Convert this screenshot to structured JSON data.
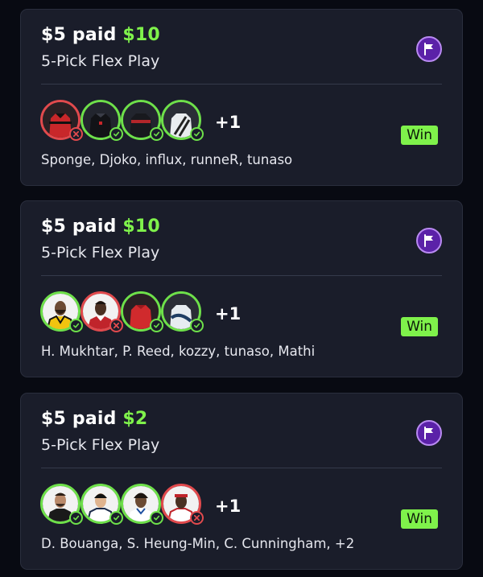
{
  "colors": {
    "background": "#080a12",
    "card": "#1a1d2a",
    "accent_green": "#7ff24b",
    "win_ring": "#6ee04a",
    "loss_ring": "#e14a4d",
    "flag_purple": "#5b21a8"
  },
  "cards": [
    {
      "paid": "$5 paid",
      "payout": "$10",
      "play_type": "5-Pick Flex Play",
      "extra_count": "+1",
      "names": "Sponge, Djoko, influx, runneR, tunaso",
      "result": "Win",
      "flag_icon": "flag-icon",
      "picks": [
        {
          "status": "loss",
          "avatar": "jersey-red-black"
        },
        {
          "status": "win",
          "avatar": "jersey-black"
        },
        {
          "status": "win",
          "avatar": "jersey-black-red"
        },
        {
          "status": "win",
          "avatar": "jersey-white-black"
        }
      ]
    },
    {
      "paid": "$5 paid",
      "payout": "$10",
      "play_type": "5-Pick Flex Play",
      "extra_count": "+1",
      "names": "H. Mukhtar, P. Reed, kozzy, tunaso, Mathi",
      "result": "Win",
      "flag_icon": "flag-icon",
      "picks": [
        {
          "status": "win",
          "avatar": "player-yellow-kit"
        },
        {
          "status": "loss",
          "avatar": "player-red-kit"
        },
        {
          "status": "win",
          "avatar": "jersey-red"
        },
        {
          "status": "win",
          "avatar": "jersey-white-blue"
        }
      ]
    },
    {
      "paid": "$5 paid",
      "payout": "$2",
      "play_type": "5-Pick Flex Play",
      "extra_count": "+1",
      "names": "D. Bouanga, S. Heung-Min, C. Cunningham, +2",
      "result": "Win",
      "flag_icon": "flag-icon",
      "picks": [
        {
          "status": "win",
          "avatar": "player-black-kit"
        },
        {
          "status": "win",
          "avatar": "player-white-kit"
        },
        {
          "status": "win",
          "avatar": "player-white-blue-kit"
        },
        {
          "status": "loss",
          "avatar": "player-red-headband"
        }
      ]
    }
  ]
}
